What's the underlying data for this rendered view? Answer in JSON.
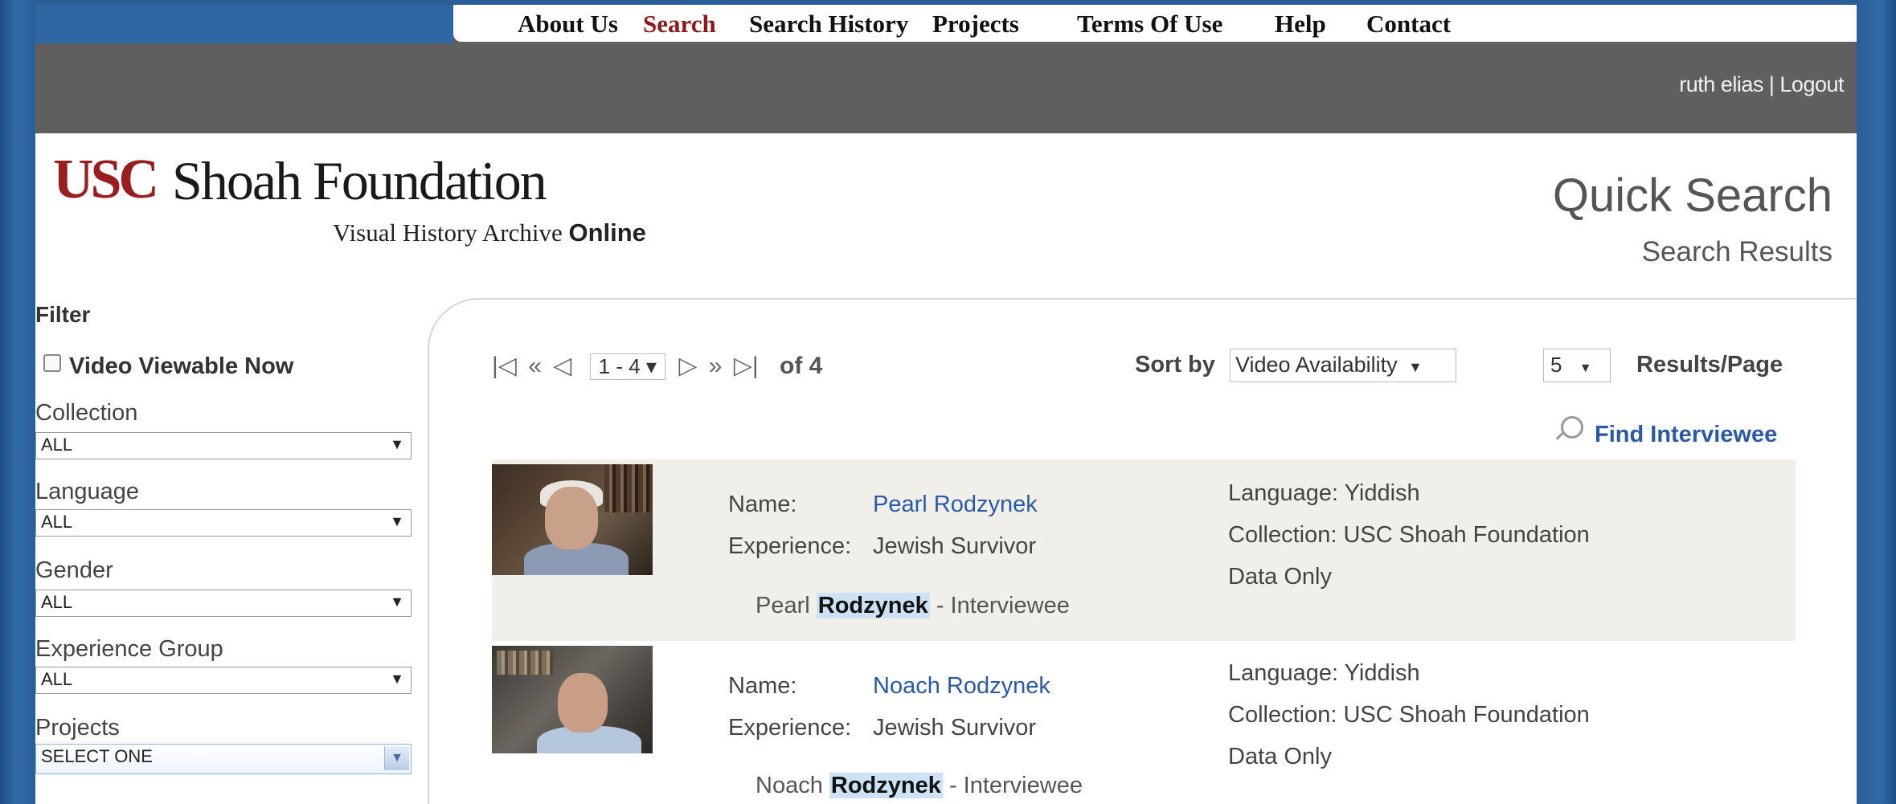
{
  "nav": {
    "items": [
      "About Us",
      "Search",
      "Search History",
      "Projects",
      "Terms Of Use",
      "Help",
      "Contact"
    ],
    "active": "Search"
  },
  "user": {
    "name": "ruth elias",
    "separator": "|",
    "logout": "Logout"
  },
  "header": {
    "logo_usc": "USC",
    "logo_name": "Shoah Foundation",
    "logo_sub": "Visual History Archive",
    "logo_sub_bold": "Online",
    "title": "Quick Search",
    "subtitle": "Search Results"
  },
  "filter": {
    "title": "Filter",
    "video_viewable": "Video Viewable Now",
    "collection_label": "Collection",
    "collection_value": "ALL",
    "language_label": "Language",
    "language_value": "ALL",
    "gender_label": "Gender",
    "gender_value": "ALL",
    "experience_label": "Experience Group",
    "experience_value": "ALL",
    "projects_label": "Projects",
    "projects_value": "SELECT ONE"
  },
  "toolbar": {
    "page_range": "1 - 4",
    "of_text": "of 4",
    "sort_label": "Sort by",
    "sort_value": "Video Availability",
    "per_page_value": "5",
    "per_page_label": "Results/Page",
    "find": "Find Interviewee"
  },
  "results": [
    {
      "name_label": "Name:",
      "name": "Pearl Rodzynek",
      "experience_label": "Experience:",
      "experience": "Jewish Survivor",
      "language": "Language: Yiddish",
      "collection": "Collection: USC Shoah Foundation",
      "availability": "Data Only",
      "snippet_pre": "Pearl",
      "snippet_hl": "Rodzynek",
      "snippet_post": "- Interviewee"
    },
    {
      "name_label": "Name:",
      "name": "Noach Rodzynek",
      "experience_label": "Experience:",
      "experience": "Jewish Survivor",
      "language": "Language: Yiddish",
      "collection": "Collection: USC Shoah Foundation",
      "availability": "Data Only",
      "snippet_pre": "Noach",
      "snippet_hl": "Rodzynek",
      "snippet_post": "- Interviewee"
    }
  ]
}
